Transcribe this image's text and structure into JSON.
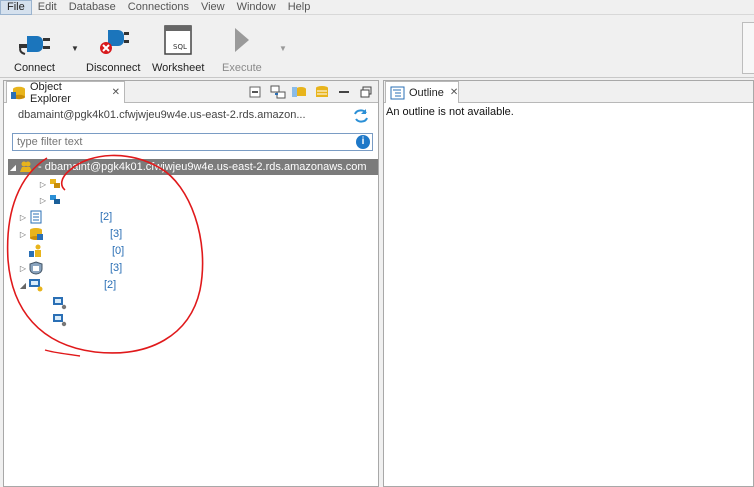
{
  "menu": [
    "File",
    "Edit",
    "Database",
    "Connections",
    "View",
    "Window",
    "Help"
  ],
  "toolbar": {
    "connect": "Connect",
    "disconnect": "Disconnect",
    "worksheet": "Worksheet",
    "execute": "Execute"
  },
  "object_explorer": {
    "tab_title": "Object Explorer",
    "connection": "dbamaint@pgk4k01.cfwjwjeu9w4e.us-east-2.rds.amazon...",
    "filter_placeholder": "type filter text",
    "root_label": "- dbamaint@pgk4k01.cfwjwjeu9w4e.us-east-2.rds.amazonaws.com",
    "counts": [
      "[2]",
      "[3]",
      "[0]",
      "[3]",
      "[2]"
    ]
  },
  "outline": {
    "tab_title": "Outline",
    "message": "An outline is not available."
  },
  "colors": {
    "accent_blue": "#2a6fb5",
    "selection_gray": "#7b7b7b",
    "annotation_red": "#e0191b"
  }
}
